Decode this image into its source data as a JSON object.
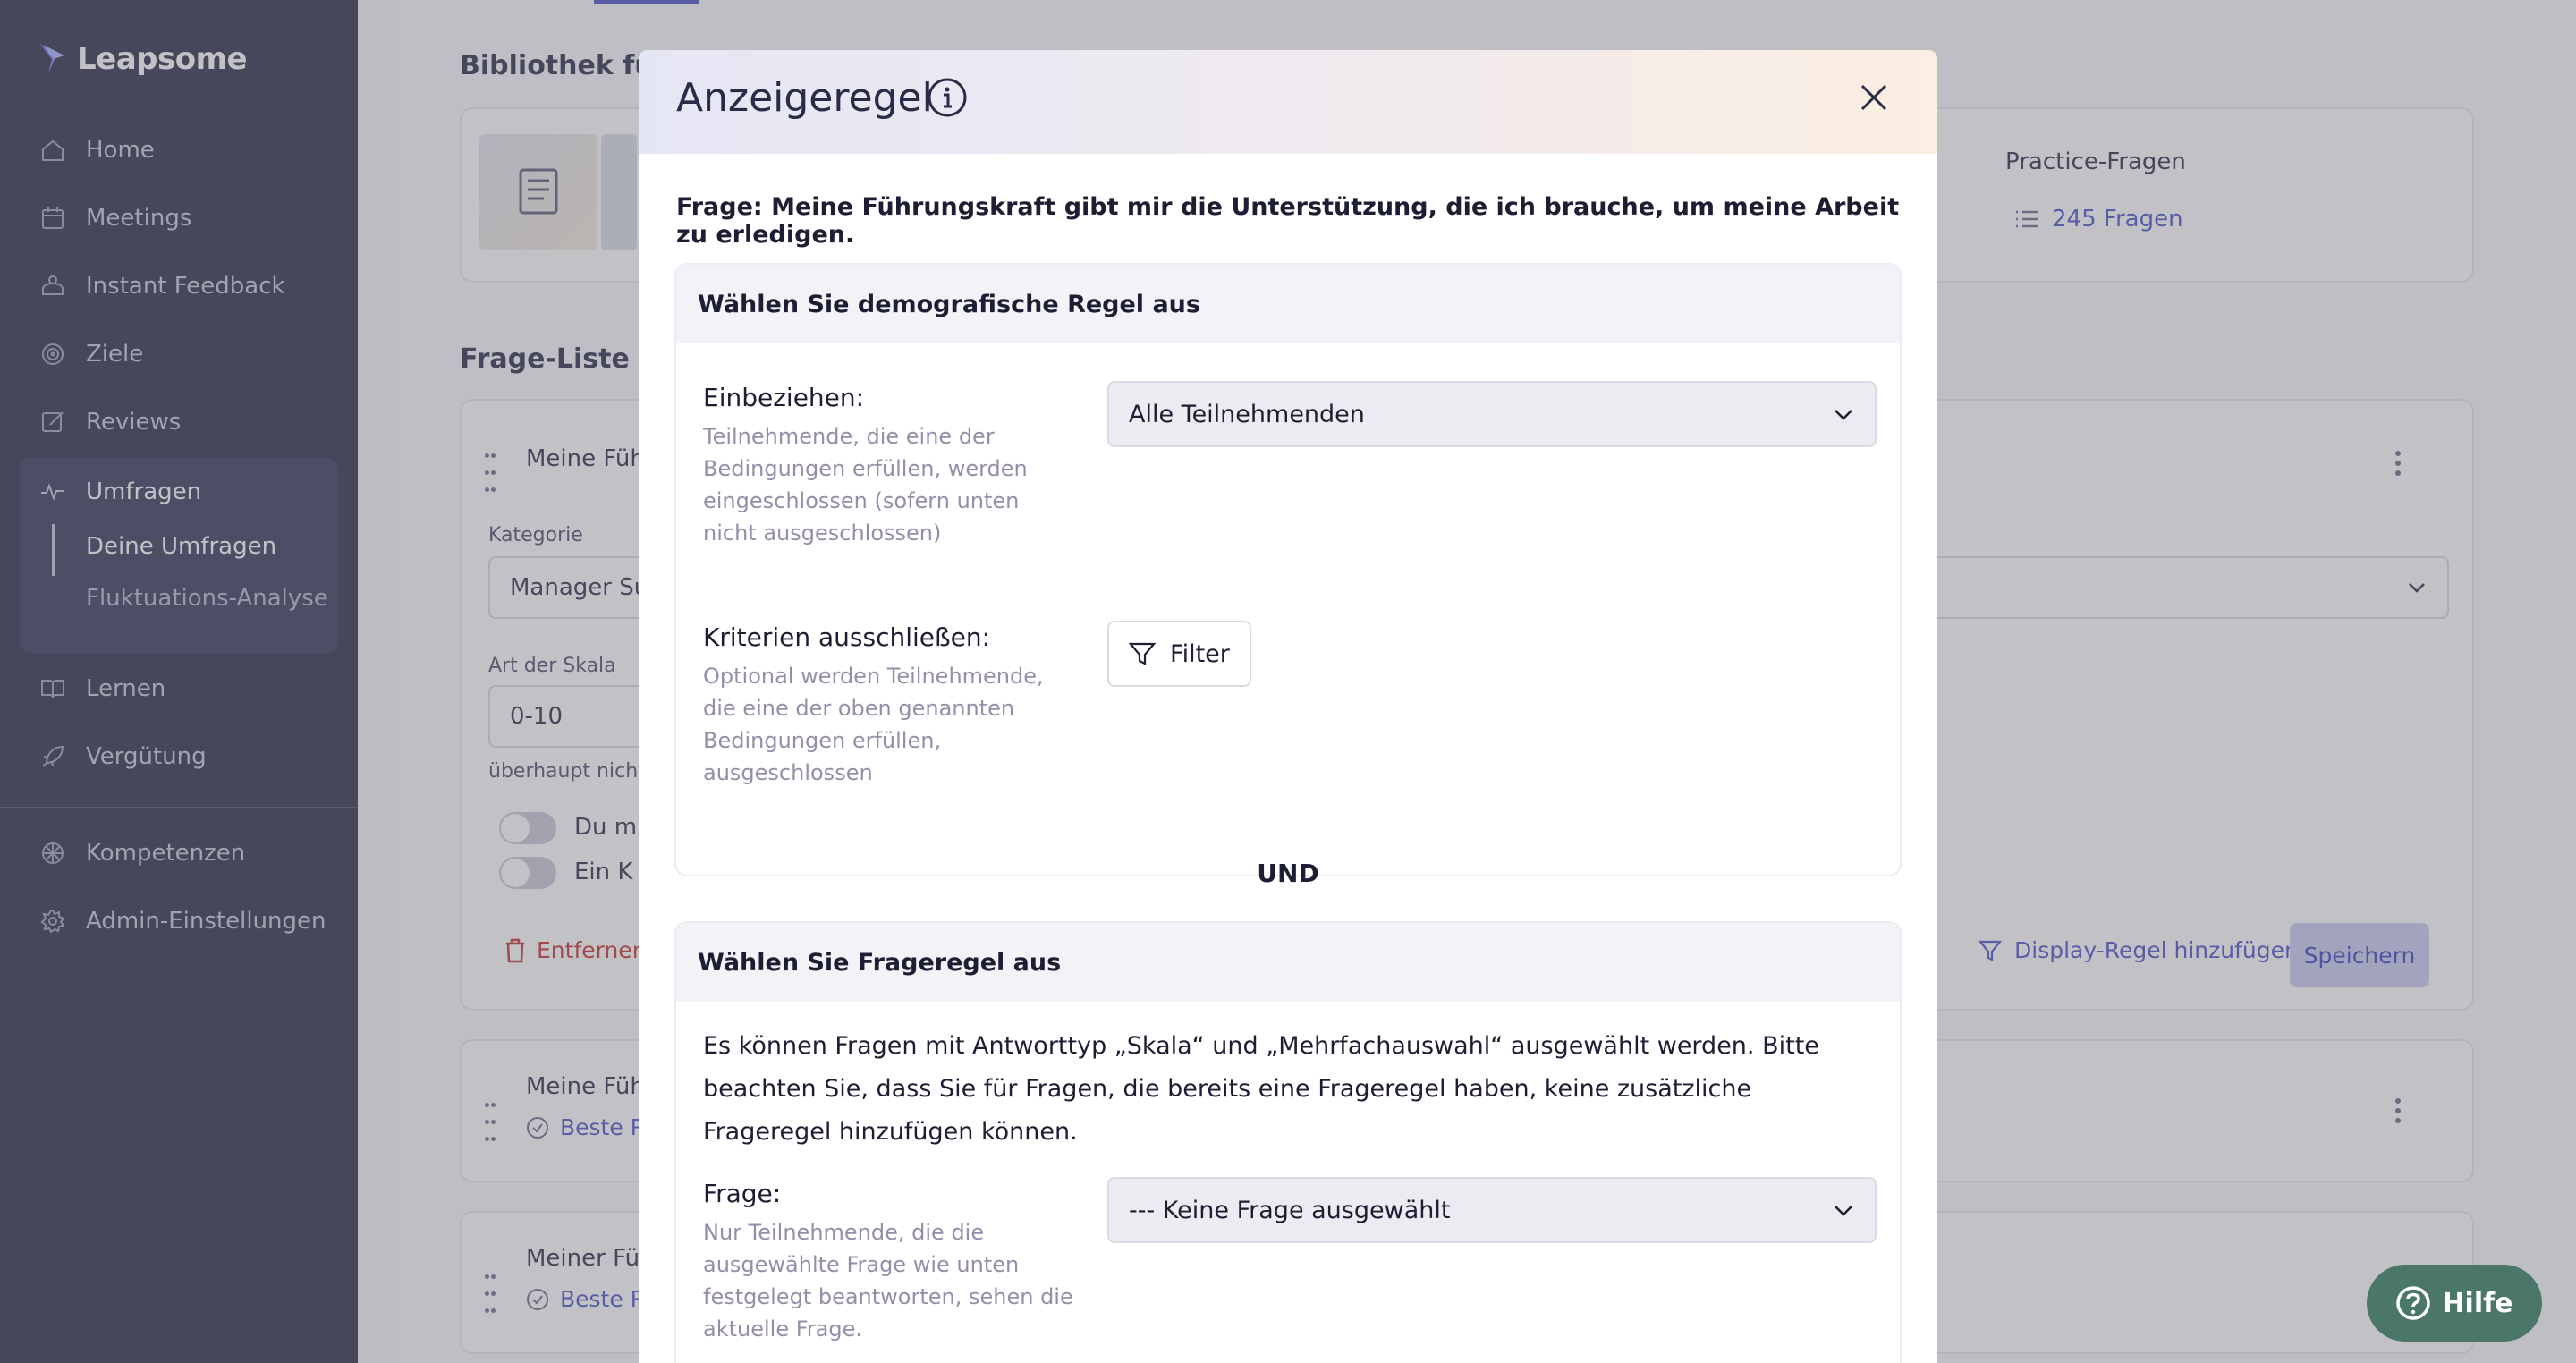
{
  "sidebar": {
    "brand": "Leapsome",
    "items": [
      {
        "label": "Home",
        "icon": "home-icon"
      },
      {
        "label": "Meetings",
        "icon": "meetings-icon"
      },
      {
        "label": "Instant Feedback",
        "icon": "feedback-icon"
      },
      {
        "label": "Ziele",
        "icon": "target-icon"
      },
      {
        "label": "Reviews",
        "icon": "reviews-icon"
      },
      {
        "label": "Umfragen",
        "icon": "pulse-icon"
      },
      {
        "label": "Lernen",
        "icon": "book-icon"
      },
      {
        "label": "Vergütung",
        "icon": "rocket-icon"
      },
      {
        "label": "Kompetenzen",
        "icon": "competency-icon"
      },
      {
        "label": "Admin-Einstellungen",
        "icon": "gear-icon"
      }
    ],
    "subitems": [
      {
        "label": "Deine Umfragen",
        "active": true
      },
      {
        "label": "Fluktuations-Analyse",
        "active": false
      }
    ]
  },
  "background": {
    "library_title": "Bibliothek für",
    "practice_title": "Practice-Fragen",
    "question_count": "245 Fragen",
    "question_list_title": "Frage-Liste",
    "q1_title": "Meine Füh",
    "category_label": "Kategorie",
    "category_value": "Manager Su",
    "scale_label": "Art der Skala",
    "scale_value": "0-10",
    "scale_hint": "überhaupt nicht",
    "toggle1": "Du m",
    "toggle2": "Ein K",
    "remove_label": "Entfernen",
    "add_display_rule": "Display-Regel hinzufügen",
    "save_label": "Speichern",
    "q2_title": "Meine Füh",
    "q2_tag": "Beste P",
    "q3_title": "Meiner Füh",
    "q3_tag": "Beste P"
  },
  "modal": {
    "title": "Anzeigeregel",
    "question": "Frage: Meine Führungskraft gibt mir die Unterstützung, die ich brauche, um meine Arbeit zu erledigen.",
    "demographic": {
      "heading": "Wählen Sie demografische Regel aus",
      "include_label": "Einbeziehen:",
      "include_help": "Teilnehmende, die eine der Bedingungen erfüllen, werden eingeschlossen (sofern unten nicht ausgeschlossen)",
      "include_value": "Alle Teilnehmenden",
      "exclude_label": "Kriterien ausschließen:",
      "exclude_help": "Optional werden Teilnehmende, die eine der oben genannten Bedingungen erfüllen, ausgeschlossen",
      "filter_label": "Filter"
    },
    "and_label": "UND",
    "question_rule": {
      "heading": "Wählen Sie Frageregel aus",
      "description": "Es können Fragen mit Antworttyp „Skala“ und „Mehrfachauswahl“ ausgewählt werden. Bitte beachten Sie, dass Sie für Fragen, die bereits eine Frageregel haben, keine zusätzliche Frageregel hinzufügen können.",
      "question_label": "Frage:",
      "question_help": "Nur Teilnehmende, die die ausgewählte Frage wie unten festgelegt beantworten, sehen die aktuelle Frage.",
      "question_value": "--- Keine Frage ausgewählt"
    }
  },
  "help_button": "Hilfe"
}
